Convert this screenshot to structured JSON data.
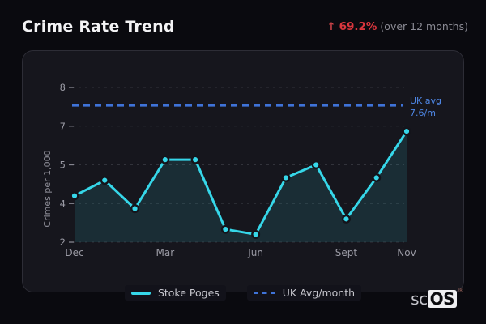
{
  "header": {
    "title": "Crime Rate Trend",
    "stat_arrow": "↑",
    "stat_value": "69.2%",
    "stat_context": "(over 12 months)"
  },
  "colors": {
    "series_cyan": "#36d7e9",
    "uk_blue": "#3f73d8",
    "uk_label_blue": "#4e87e6",
    "trend_red": "#d9363d",
    "axis_text": "#9a9aa4",
    "grid_line": "rgba(150,155,170,0.22)",
    "area_fill": "rgba(54,215,233,0.12)",
    "point_ring": "#14141b"
  },
  "chart_data": {
    "type": "line",
    "title": "Crime Rate Trend",
    "ylabel": "Crimes per 1,000",
    "ylim": [
      2,
      8
    ],
    "ytick_labels": [
      "2",
      "4",
      "5",
      "7",
      "8"
    ],
    "xticks": [
      {
        "index": 0,
        "label": "Dec"
      },
      {
        "index": 3,
        "label": "Mar"
      },
      {
        "index": 6,
        "label": "Jun"
      },
      {
        "index": 9,
        "label": "Sept"
      },
      {
        "index": 11,
        "label": "Nov"
      }
    ],
    "series": [
      {
        "name": "Stoke Poges",
        "values": [
          3.8,
          4.4,
          3.3,
          5.2,
          5.2,
          2.5,
          2.3,
          4.5,
          5.0,
          2.9,
          4.5,
          6.3
        ]
      }
    ],
    "reference_line": {
      "name": "UK Avg/month",
      "label_lines": [
        "UK avg",
        "7.6/m"
      ],
      "value": 7.6,
      "plotted_at": 7.3
    },
    "grid": true,
    "legend_position": "bottom"
  },
  "legend": {
    "items": [
      {
        "label": "Stoke Poges",
        "swatch": "solid-cyan-line"
      },
      {
        "label": "UK Avg/month",
        "swatch": "dashed-blue-line"
      }
    ]
  },
  "logo": {
    "prefix": "sc",
    "suffix": "OS",
    "registered_mark": "®"
  }
}
